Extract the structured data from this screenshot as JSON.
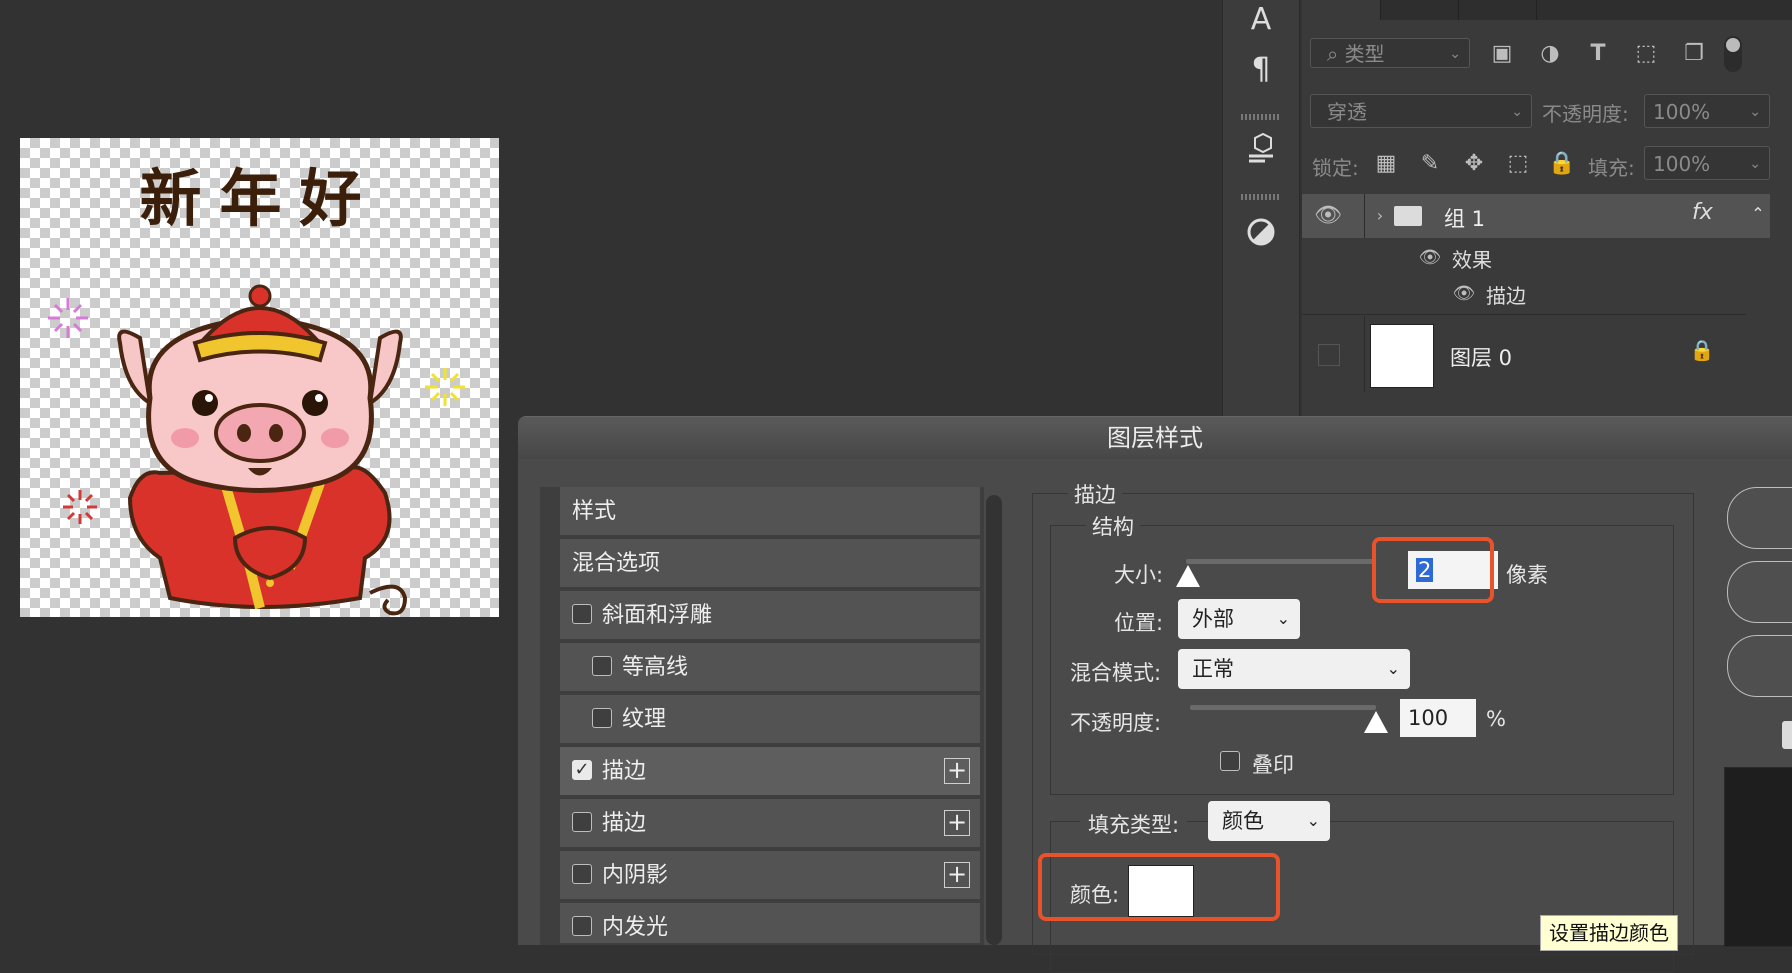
{
  "canvas_text": "新年好",
  "toolstrip": {
    "type_tool": "A",
    "paragraph": "¶"
  },
  "layers_panel": {
    "filter_kind": "类型",
    "blend_mode": "穿透",
    "opacity_label": "不透明度:",
    "opacity_value": "100%",
    "lock_label": "锁定:",
    "fill_label": "填充:",
    "fill_value": "100%",
    "layers": [
      {
        "name": "组 1",
        "fx": "fx"
      },
      {
        "name": "效果"
      },
      {
        "name": "描边"
      },
      {
        "name": "图层 0"
      }
    ]
  },
  "dialog": {
    "title": "图层样式",
    "styles_header": "样式",
    "blend_options": "混合选项",
    "items": [
      {
        "label": "斜面和浮雕",
        "checked": false
      },
      {
        "label": "等高线",
        "checked": false
      },
      {
        "label": "纹理",
        "checked": false
      },
      {
        "label": "描边",
        "checked": true
      },
      {
        "label": "描边",
        "checked": false
      },
      {
        "label": "内阴影",
        "checked": false
      },
      {
        "label": "内发光",
        "checked": false
      }
    ],
    "stroke": {
      "section_title": "描边",
      "structure_title": "结构",
      "size_label": "大小:",
      "size_value": "2",
      "size_unit": "像素",
      "size_fraction": 0.01,
      "position_label": "位置:",
      "position_value": "外部",
      "blend_label": "混合模式:",
      "blend_value": "正常",
      "opacity_label": "不透明度:",
      "opacity_value": "100",
      "opacity_unit": "%",
      "opacity_fraction": 1.0,
      "overprint_label": "叠印",
      "fill_type_label": "填充类型:",
      "fill_type_value": "颜色",
      "color_label": "颜色:",
      "color_value": "#ffffff",
      "tooltip": "设置描边颜色"
    }
  },
  "colors": {
    "highlight": "#e8532b",
    "selection": "#2d6ad6"
  }
}
